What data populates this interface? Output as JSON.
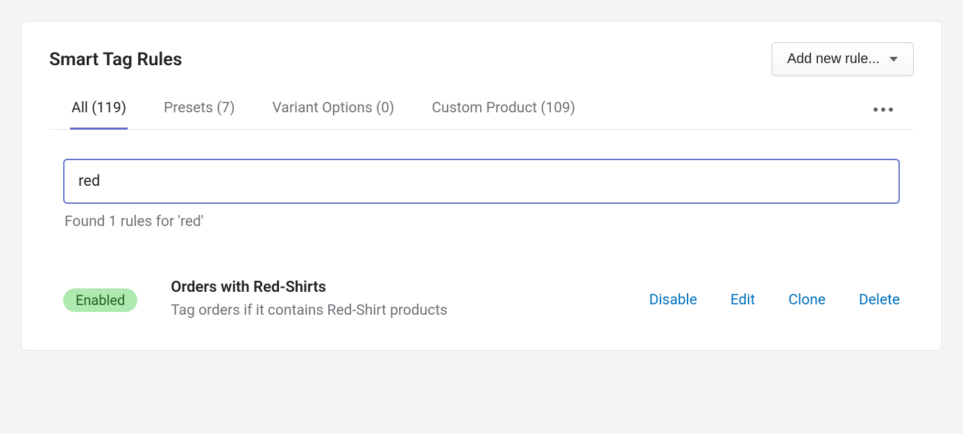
{
  "header": {
    "title": "Smart Tag Rules",
    "add_button_label": "Add new rule..."
  },
  "tabs": [
    {
      "label": "All (119)",
      "active": true
    },
    {
      "label": "Presets (7)",
      "active": false
    },
    {
      "label": "Variant Options (0)",
      "active": false
    },
    {
      "label": "Custom Product (109)",
      "active": false
    }
  ],
  "search": {
    "value": "red",
    "result_text": "Found 1 rules for 'red'"
  },
  "rules": [
    {
      "status_label": "Enabled",
      "title": "Orders with Red-Shirts",
      "description": "Tag orders if it contains Red-Shirt products",
      "actions": {
        "disable": "Disable",
        "edit": "Edit",
        "clone": "Clone",
        "delete": "Delete"
      }
    }
  ]
}
